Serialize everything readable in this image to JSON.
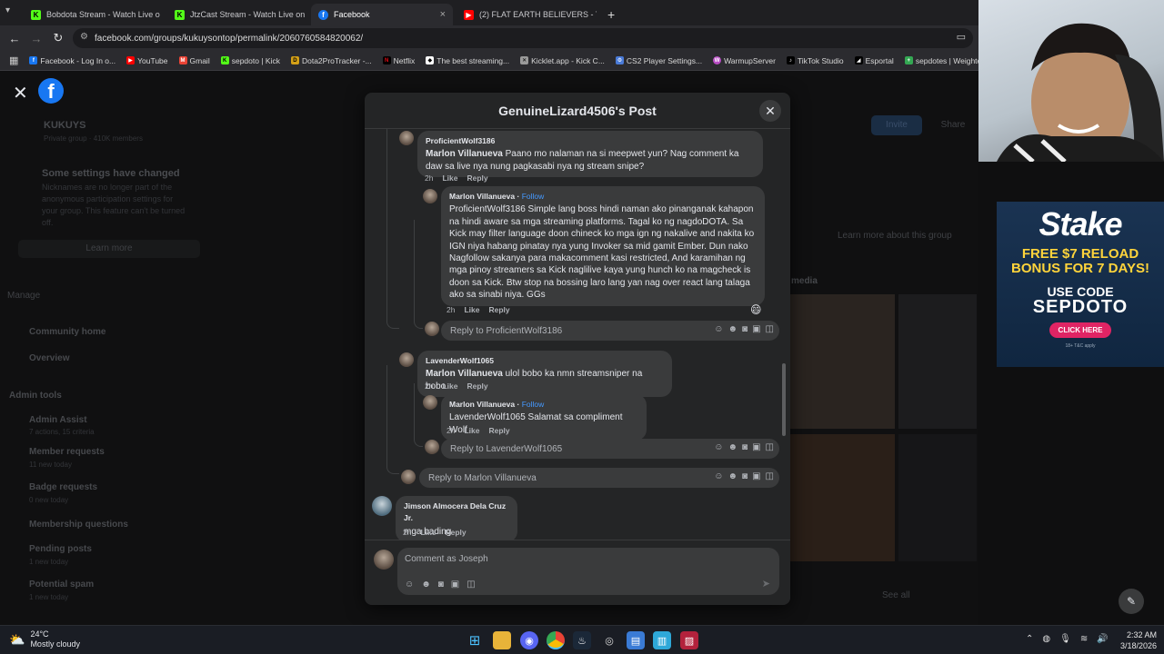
{
  "browser": {
    "tabs": [
      {
        "title": "Bobdota Stream - Watch Live o",
        "icon": "kick-icon",
        "color": "#53fc18"
      },
      {
        "title": "JtzCast Stream - Watch Live on",
        "icon": "kick-icon",
        "color": "#53fc18"
      },
      {
        "title": "Facebook",
        "icon": "facebook-icon",
        "color": "#1877f2"
      },
      {
        "title": "(2) FLAT EARTH BELIEVERS - Yo",
        "icon": "youtube-icon",
        "color": "#ff0000"
      }
    ],
    "url": "facebook.com/groups/kukuysontop/permalink/2060760584820062/",
    "bookmarks": [
      "Facebook - Log In o...",
      "YouTube",
      "Gmail",
      "sepdoto | Kick",
      "Dota2ProTracker -...",
      "Netflix",
      "The best streaming...",
      "Kicklet.app - Kick C...",
      "CS2 Player Settings...",
      "WarmupServer",
      "TikTok Studio",
      "Esportal",
      "sepdotes | Weighte..."
    ]
  },
  "background": {
    "group_name": "KUKUYS",
    "group_meta": "Private group · 410K members",
    "notice_title": "Some settings have changed",
    "notice_body": "Nicknames are no longer part of the anonymous participation settings for your group. This feature can't be turned off.",
    "learn_more": "Learn more",
    "manage": "Manage",
    "community_home": "Community home",
    "overview": "Overview",
    "admin_tools": "Admin tools",
    "admin_items": [
      {
        "label": "Admin Assist",
        "sub": "7 actions, 15 criteria"
      },
      {
        "label": "Member requests",
        "sub": "11 new today"
      },
      {
        "label": "Badge requests",
        "sub": "0 new today"
      },
      {
        "label": "Membership questions",
        "sub": ""
      },
      {
        "label": "Pending posts",
        "sub": "1 new today"
      },
      {
        "label": "Potential spam",
        "sub": "1 new today"
      }
    ],
    "right_learn_more": "Learn more about this group",
    "media": "media",
    "see_all": "See all",
    "invite": "Invite",
    "share": "Share"
  },
  "modal": {
    "title": "GenuineLizard4506's Post",
    "comments": [
      {
        "author": "ProficientWolf3186",
        "tag": "Marlon Villanueva",
        "text": "Paano mo nalaman na si meepwet yun? Nag comment ka daw sa live nya nung pagkasabi nya ng stream snipe?",
        "time": "2h"
      },
      {
        "author": "Marlon Villanueva",
        "follow": "Follow",
        "text": "ProficientWolf3186 Simple lang boss hindi naman ako pinanganak kahapon na hindi aware sa mga streaming platforms. Tagal ko ng nagdoDOTA. Sa Kick may filter language doon chineck ko mga ign ng nakalive and nakita ko IGN niya habang pinatay nya yung Invoker sa mid gamit Ember. Dun nako Nagfollow sakanya para makacomment kasi restricted, And karamihan ng mga pinoy streamers sa Kick naglilive kaya yung hunch ko na magcheck is doon sa Kick. Btw stop na bossing laro lang yan nag over react lang talaga ako sa sinabi niya. GGs",
        "time": "2h"
      },
      {
        "author": "LavenderWolf1065",
        "tag": "Marlon Villanueva",
        "text": "ulol bobo ka nmn streamsniper na bobo",
        "time": "2h"
      },
      {
        "author": "Marlon Villanueva",
        "follow": "Follow",
        "text": "LavenderWolf1065 Salamat sa compliment Wolf",
        "time": "2h"
      },
      {
        "author": "Jimson Almocera Dela Cruz Jr.",
        "text": "mga bading",
        "time": "2h"
      }
    ],
    "like": "Like",
    "reply": "Reply",
    "reply_placeholders": [
      "Reply to ProficientWolf3186",
      "Reply to LavenderWolf1065",
      "Reply to Marlon Villanueva"
    ],
    "comment_placeholder": "Comment as Joseph"
  },
  "stake_ad": {
    "logo": "Stake",
    "promo1": "FREE $7 RELOAD",
    "promo2": "BONUS FOR 7 DAYS!",
    "code_label": "USE CODE",
    "code": "SEPDOTO",
    "cta": "CLICK HERE",
    "fine": "18+ T&C apply"
  },
  "taskbar": {
    "temp": "24°C",
    "weather": "Mostly cloudy",
    "time": "2:32 AM",
    "date": "3/18/2026"
  }
}
